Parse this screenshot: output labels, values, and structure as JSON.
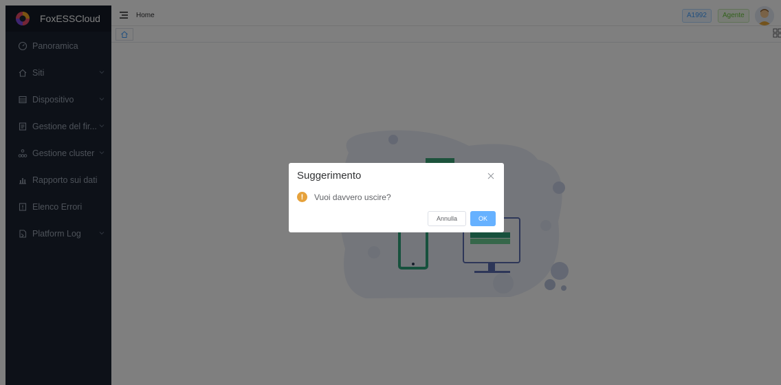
{
  "app": {
    "brand": "FoxESSCloud"
  },
  "sidebar": {
    "items": [
      {
        "label": "Panoramica",
        "icon": "dashboard-icon",
        "has_arrow": false
      },
      {
        "label": "Siti",
        "icon": "home-icon",
        "has_arrow": true
      },
      {
        "label": "Dispositivo",
        "icon": "device-icon",
        "has_arrow": true
      },
      {
        "label": "Gestione del fir...",
        "icon": "firmware-icon",
        "has_arrow": true
      },
      {
        "label": "Gestione cluster",
        "icon": "cluster-icon",
        "has_arrow": true
      },
      {
        "label": "Rapporto sui dati",
        "icon": "chart-icon",
        "has_arrow": false
      },
      {
        "label": "Elenco Errori",
        "icon": "error-list-icon",
        "has_arrow": false
      },
      {
        "label": "Platform Log",
        "icon": "log-icon",
        "has_arrow": true
      }
    ]
  },
  "header": {
    "breadcrumb": "Home",
    "tag_user": "A1992",
    "tag_role": "Agente"
  },
  "dialog": {
    "title": "Suggerimento",
    "message": "Vuoi davvero uscire?",
    "cancel_label": "Annulla",
    "ok_label": "OK"
  },
  "colors": {
    "sidebar_bg": "#1a2230",
    "primary": "#409eff",
    "warning": "#e6a23c",
    "success": "#67c23a"
  }
}
